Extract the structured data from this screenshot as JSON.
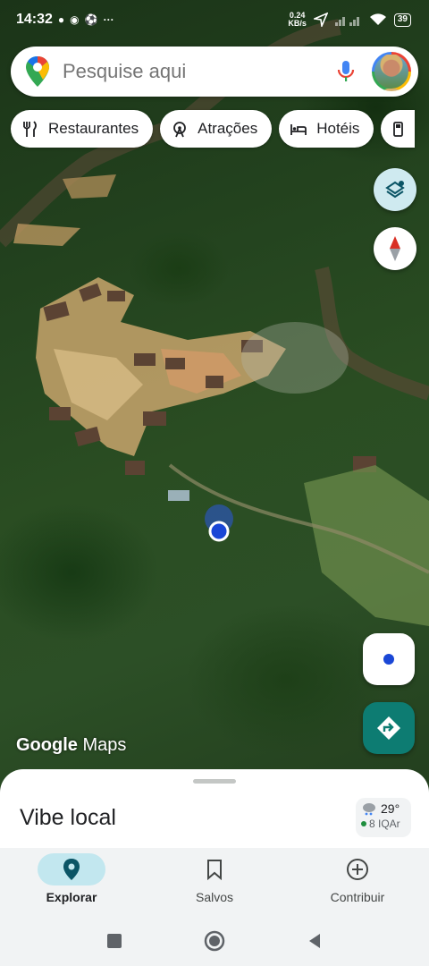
{
  "status_bar": {
    "time": "14:32",
    "net_speed_value": "0.24",
    "net_speed_unit": "KB/s",
    "battery": "39"
  },
  "search": {
    "placeholder": "Pesquise aqui"
  },
  "chips": [
    {
      "label": "Restaurantes",
      "icon": "fork-knife-icon"
    },
    {
      "label": "Atrações",
      "icon": "ferris-wheel-icon"
    },
    {
      "label": "Hotéis",
      "icon": "bed-icon"
    },
    {
      "label": "",
      "icon": "gas-station-icon"
    }
  ],
  "map": {
    "logo_google": "Google",
    "logo_maps": "Maps"
  },
  "sheet": {
    "title": "Vibe local",
    "weather_temp": "29°",
    "weather_aqi": "8 IQAr"
  },
  "bottom_nav": [
    {
      "label": "Explorar",
      "icon": "location-pin-icon",
      "active": true
    },
    {
      "label": "Salvos",
      "icon": "bookmark-icon",
      "active": false
    },
    {
      "label": "Contribuir",
      "icon": "add-circle-icon",
      "active": false
    }
  ],
  "colors": {
    "accent_teal": "#0d7c72",
    "active_nav_bg": "#c2e7ef",
    "location_blue": "#1a47d6"
  }
}
